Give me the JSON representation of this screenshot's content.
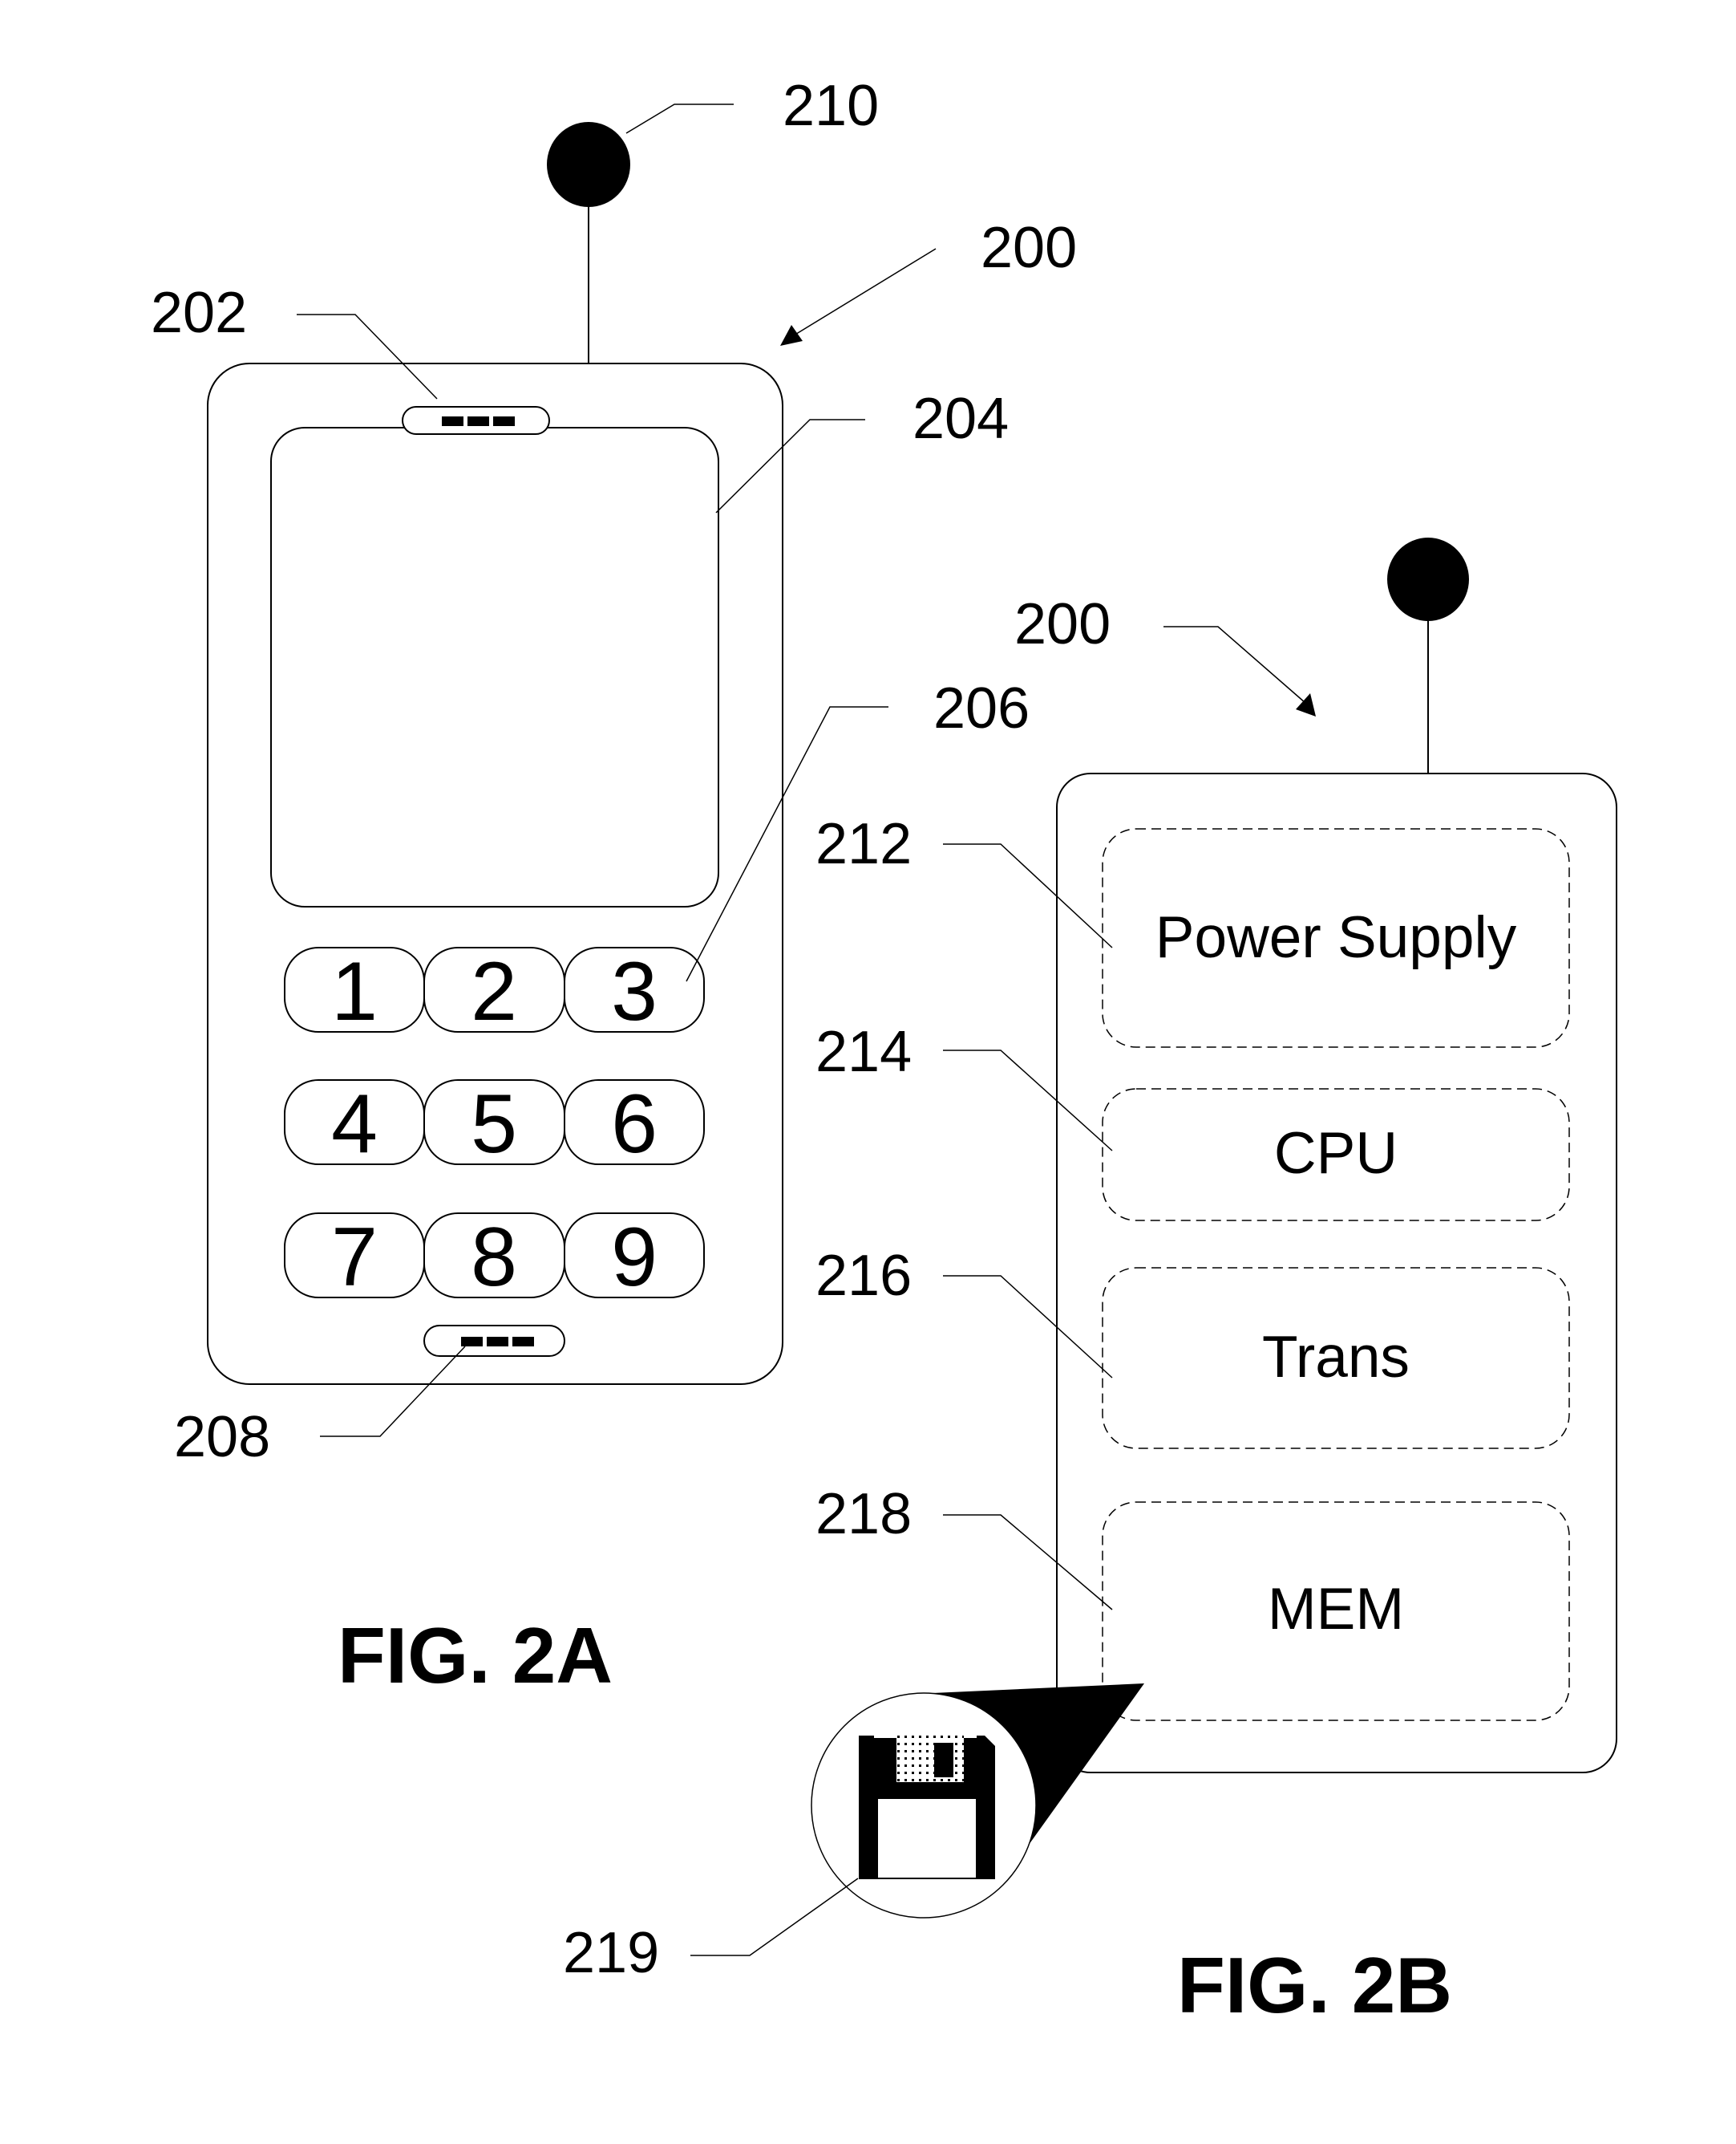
{
  "figures": {
    "fig_2a": {
      "caption": "FIG. 2A",
      "refs": {
        "device": "200",
        "earpiece": "202",
        "display": "204",
        "keypad": "206",
        "microphone": "208",
        "antenna": "210"
      },
      "keys": [
        "1",
        "2",
        "3",
        "4",
        "5",
        "6",
        "7",
        "8",
        "9"
      ]
    },
    "fig_2b": {
      "caption": "FIG. 2B",
      "refs": {
        "device": "200",
        "power_supply": "212",
        "cpu": "214",
        "trans": "216",
        "mem": "218",
        "storage_medium": "219"
      },
      "components": [
        "Power Supply",
        "CPU",
        "Trans",
        "MEM"
      ],
      "storage_icon": "floppy-disk-icon"
    }
  },
  "colors": {
    "ink": "#000000",
    "paper": "#ffffff"
  }
}
